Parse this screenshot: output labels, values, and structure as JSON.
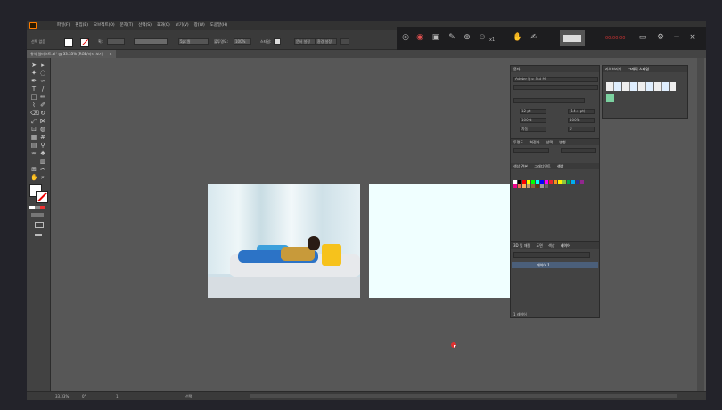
{
  "app": {
    "name": "Adobe Illustrator",
    "logo_icon": "ai-logo-icon",
    "accent": "#ff7c00"
  },
  "menubar": {
    "items": [
      "파일(F)",
      "편집(E)",
      "오브젝트(O)",
      "문자(T)",
      "선택(S)",
      "효과(C)",
      "보기(V)",
      "창(W)",
      "도움말(H)"
    ]
  },
  "controlbar": {
    "no_selection": "선택 없음",
    "stroke_label": "획:",
    "stroke_value": "",
    "brush": "5pt 원",
    "opacity_label": "불투명도:",
    "opacity_value": "100%",
    "style_label": "스타일:",
    "doc_setup": "문서 설정",
    "prefs": "환경 설정"
  },
  "recorder": {
    "icons": [
      "pause-circle-icon",
      "stop-circle-icon",
      "screenshot-icon",
      "pen-icon",
      "zoom-in-icon",
      "zoom-out-icon",
      "hand-icon",
      "highlighter-icon"
    ],
    "zoom": "x1",
    "timer": "00:00:00"
  },
  "tab": {
    "title": "유식 일러스트.ai* @ 33.33% (RGB/미리 보기)",
    "close": "×"
  },
  "tools": [
    "selection-tool",
    "direct-select-tool",
    "magic-wand-tool",
    "lasso-tool",
    "pen-tool",
    "curvature-tool",
    "type-tool",
    "line-tool",
    "rectangle-tool",
    "paintbrush-tool",
    "shaper-tool",
    "pencil-tool",
    "eraser-tool",
    "rotate-tool",
    "scale-tool",
    "width-tool",
    "free-transform-tool",
    "shape-builder-tool",
    "perspective-tool",
    "mesh-tool",
    "gradient-tool",
    "eyedropper-tool",
    "blend-tool",
    "symbol-sprayer-tool",
    "column-graph-tool",
    "artboard-tool",
    "slice-tool",
    "hand-tool",
    "zoom-tool"
  ],
  "character": {
    "title": "문자",
    "font": "Adobe 명조 Std M",
    "size": "12 pt",
    "leading": "(14.4 pt)",
    "tracking": "100%",
    "kerning": "자동",
    "scale": "100%",
    "baseline": "0"
  },
  "swatches_panel": {
    "tabs": [
      "투명도",
      "회전자",
      "선택",
      "변형"
    ],
    "subtabs": [
      "색상 견본",
      "그래디언트",
      "색상"
    ],
    "active": "색상"
  },
  "layers": {
    "tabs": [
      "3D 및 재질",
      "도면",
      "색상",
      "레이어"
    ],
    "active": "레이어",
    "layer_name": "레이어 1",
    "count": "1 레이어"
  },
  "graphic_styles": {
    "tabs": [
      "라이브러리",
      "그래픽 스타일"
    ],
    "active": "그래픽 스타일"
  },
  "status": {
    "zoom": "33.33%",
    "angle": "0°",
    "page": "1",
    "mode": "선택"
  },
  "colors": {
    "artboard2": "#f0ffff",
    "canvas": "#575757"
  },
  "swatch_colors": [
    "#ffffff",
    "#000000",
    "#ff0000",
    "#ffff00",
    "#00ff00",
    "#00ffff",
    "#0000ff",
    "#ff00ff",
    "#e8262f",
    "#f7941d",
    "#fff200",
    "#8dc63f",
    "#00a651",
    "#00aeef",
    "#2e3192",
    "#92278f",
    "#ec008c",
    "#f26c4f",
    "#fbaf5d",
    "#c69c6d",
    "#8c6239",
    "#603913",
    "#999999",
    "#666666"
  ]
}
